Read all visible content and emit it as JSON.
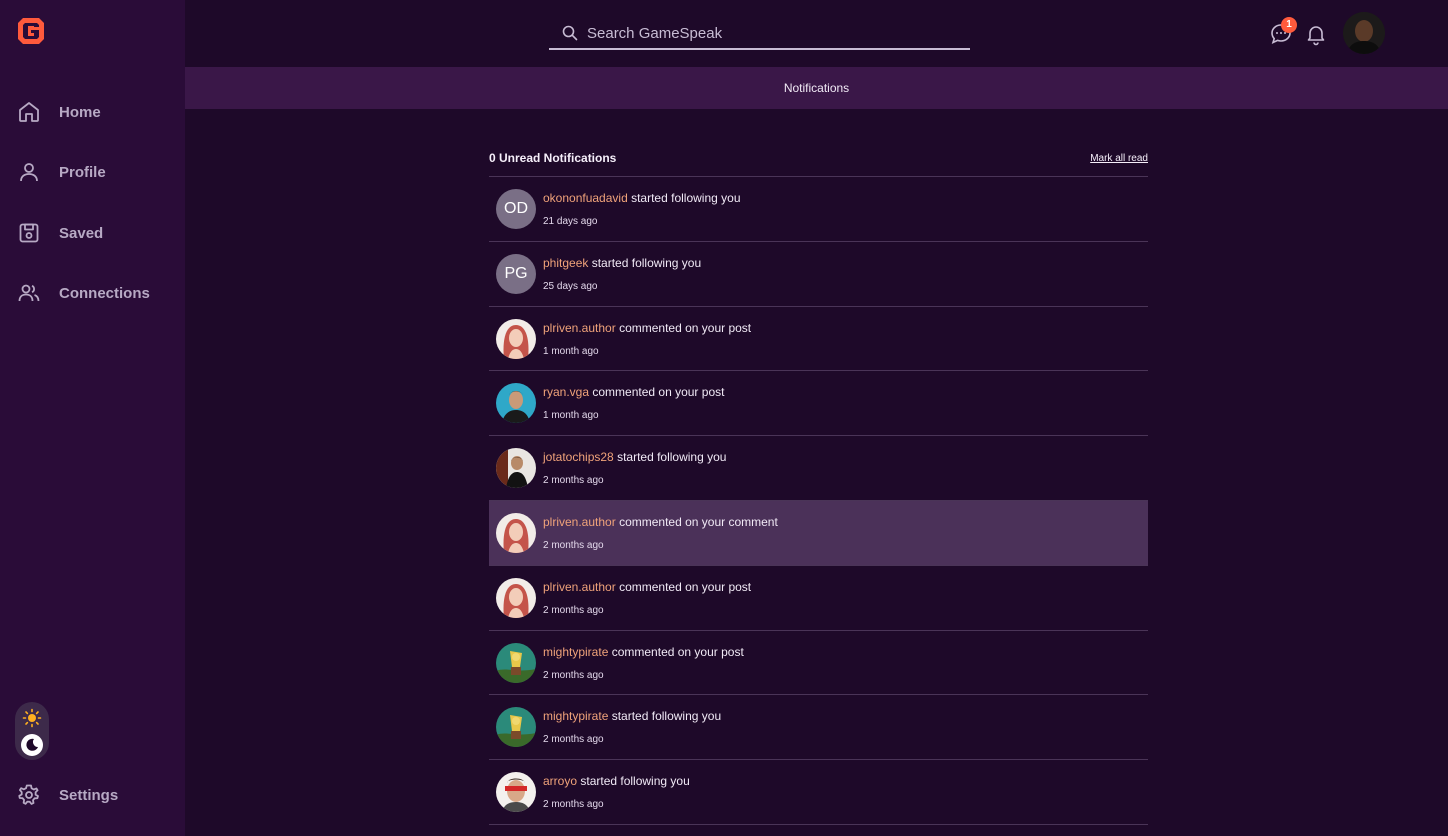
{
  "brand": {
    "logo_icon": "gamespeak-logo-icon",
    "accent": "#ff5a3c"
  },
  "sidebar": {
    "items": [
      {
        "label": "Home",
        "icon": "home-icon"
      },
      {
        "label": "Profile",
        "icon": "user-icon"
      },
      {
        "label": "Saved",
        "icon": "save-icon"
      },
      {
        "label": "Connections",
        "icon": "users-icon"
      }
    ],
    "settings": {
      "label": "Settings",
      "icon": "gear-icon"
    }
  },
  "header": {
    "search_placeholder": "Search GameSpeak",
    "chat_badge": "1"
  },
  "subheader": {
    "title": "Notifications"
  },
  "notifications": {
    "unread_label": "0 Unread Notifications",
    "mark_all_label": "Mark all read",
    "items": [
      {
        "avatar": "OD",
        "user": "okononfuadavid",
        "action": "started following you",
        "time": "21 days ago"
      },
      {
        "avatar": "PG",
        "user": "phitgeek",
        "action": "started following you",
        "time": "25 days ago"
      },
      {
        "avatar": "",
        "user": "plriven.author",
        "action": "commented on your post",
        "time": "1 month ago"
      },
      {
        "avatar": "",
        "user": "ryan.vga",
        "action": "commented on your post",
        "time": "1 month ago"
      },
      {
        "avatar": "",
        "user": "jotatochips28",
        "action": "started following you",
        "time": "2 months ago"
      },
      {
        "avatar": "",
        "user": "plriven.author",
        "action": "commented on your comment",
        "time": "2 months ago"
      },
      {
        "avatar": "",
        "user": "plriven.author",
        "action": "commented on your post",
        "time": "2 months ago"
      },
      {
        "avatar": "",
        "user": "mightypirate",
        "action": "commented on your post",
        "time": "2 months ago"
      },
      {
        "avatar": "",
        "user": "mightypirate",
        "action": "started following you",
        "time": "2 months ago"
      },
      {
        "avatar": "",
        "user": "arroyo",
        "action": "started following you",
        "time": "2 months ago"
      }
    ]
  }
}
